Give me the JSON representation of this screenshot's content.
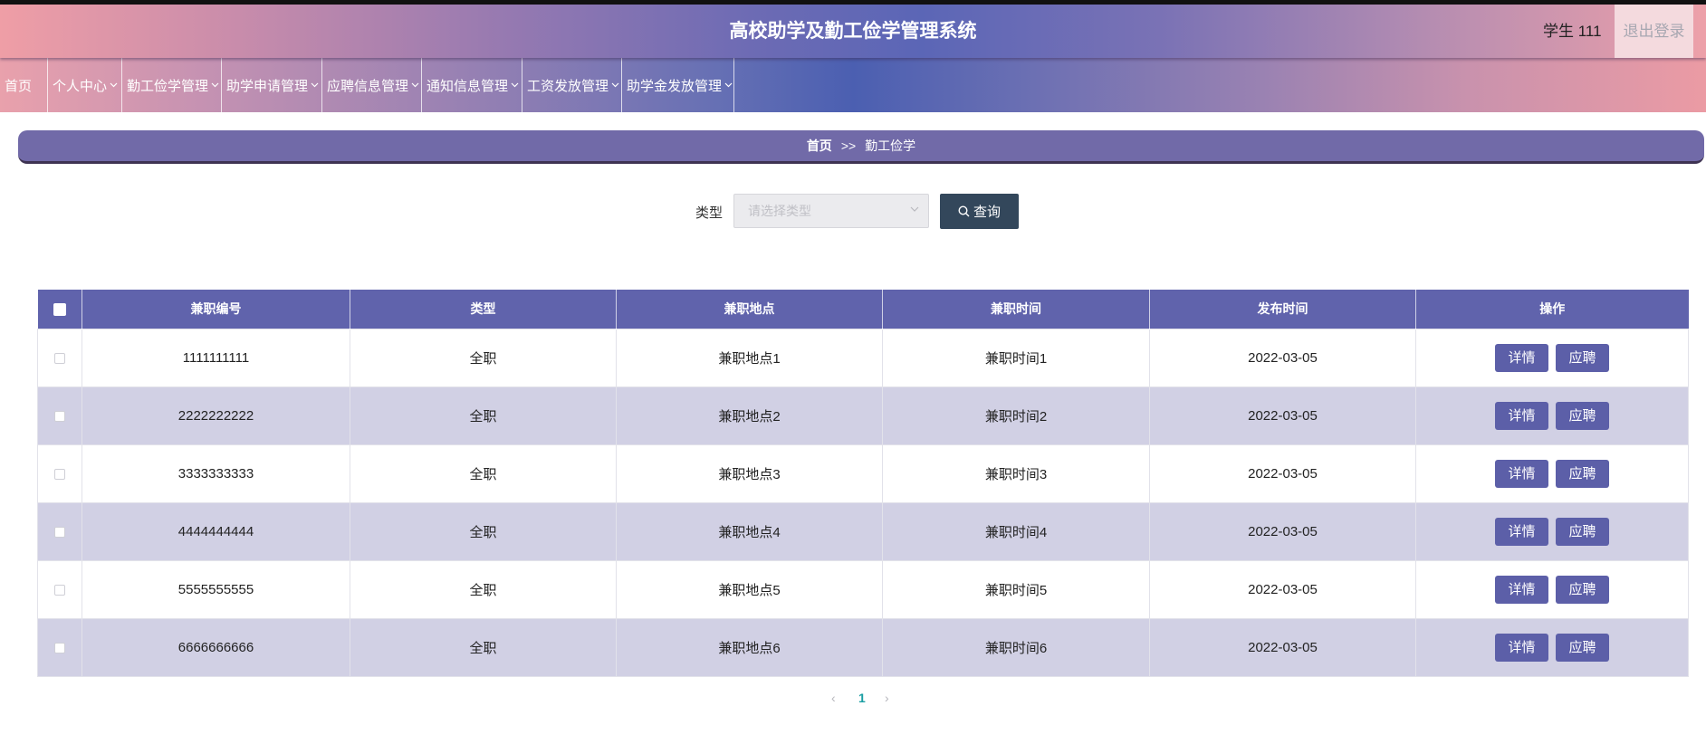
{
  "header": {
    "title": "高校助学及勤工俭学管理系统",
    "user": "学生 111",
    "logout": "退出登录"
  },
  "nav": {
    "items": [
      {
        "label": "首页"
      },
      {
        "label": "个人中心",
        "icon": "chevron-down-icon"
      },
      {
        "label": "勤工俭学管理",
        "icon": "chevron-down-icon"
      },
      {
        "label": "助学申请管理",
        "icon": "chevron-down-icon"
      },
      {
        "label": "应聘信息管理",
        "icon": "chevron-down-icon"
      },
      {
        "label": "通知信息管理",
        "icon": "chevron-down-icon"
      },
      {
        "label": "工资发放管理",
        "icon": "chevron-down-icon"
      },
      {
        "label": "助学金发放管理",
        "icon": "chevron-down-icon"
      }
    ]
  },
  "breadcrumb": {
    "home": "首页",
    "sep": ">>",
    "current": "勤工俭学"
  },
  "search": {
    "label": "类型",
    "placeholder": "请选择类型",
    "button": "查询",
    "button_icon": "search-icon"
  },
  "table": {
    "columns": [
      "兼职编号",
      "类型",
      "兼职地点",
      "兼职时间",
      "发布时间",
      "操作"
    ],
    "rows": [
      {
        "id": "1111111111",
        "type": "全职",
        "location": "兼职地点1",
        "time": "兼职时间1",
        "published": "2022-03-05"
      },
      {
        "id": "2222222222",
        "type": "全职",
        "location": "兼职地点2",
        "time": "兼职时间2",
        "published": "2022-03-05"
      },
      {
        "id": "3333333333",
        "type": "全职",
        "location": "兼职地点3",
        "time": "兼职时间3",
        "published": "2022-03-05"
      },
      {
        "id": "4444444444",
        "type": "全职",
        "location": "兼职地点4",
        "time": "兼职时间4",
        "published": "2022-03-05"
      },
      {
        "id": "5555555555",
        "type": "全职",
        "location": "兼职地点5",
        "time": "兼职时间5",
        "published": "2022-03-05"
      },
      {
        "id": "6666666666",
        "type": "全职",
        "location": "兼职地点6",
        "time": "兼职时间6",
        "published": "2022-03-05"
      }
    ],
    "actions": {
      "detail": "详情",
      "apply": "应聘"
    }
  },
  "pagination": {
    "prev_icon": "chevron-left-icon",
    "current": "1",
    "next_icon": "chevron-right-icon"
  },
  "colors": {
    "table_header": "#6063ac",
    "row_alt": "#d1d0e4",
    "action_button": "#5c5fa8",
    "search_button": "#33475b",
    "breadcrumb": "#716aa8",
    "page_active": "#1a9ea3"
  }
}
